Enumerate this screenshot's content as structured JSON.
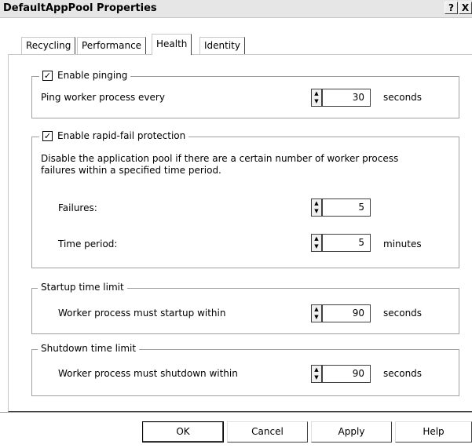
{
  "window": {
    "title": "DefaultAppPool Properties",
    "help_glyph": "?",
    "close_glyph": "X"
  },
  "tabs": [
    {
      "label": "Recycling",
      "active": false
    },
    {
      "label": "Performance",
      "active": false
    },
    {
      "label": "Health",
      "active": true
    },
    {
      "label": "Identity",
      "active": false
    }
  ],
  "pinging": {
    "checkbox_label": "Enable pinging",
    "checked": true,
    "row_label": "Ping worker process every",
    "value": "30",
    "unit": "seconds"
  },
  "rapid_fail": {
    "checkbox_label": "Enable rapid-fail protection",
    "checked": true,
    "description": "Disable the application pool if there are a certain number of worker process failures within a specified time period.",
    "failures_label": "Failures:",
    "failures_value": "5",
    "time_period_label": "Time period:",
    "time_period_value": "5",
    "time_period_unit": "minutes"
  },
  "startup": {
    "legend": "Startup time limit",
    "row_label": "Worker process must startup within",
    "value": "90",
    "unit": "seconds"
  },
  "shutdown": {
    "legend": "Shutdown time limit",
    "row_label": "Worker process must shutdown within",
    "value": "90",
    "unit": "seconds"
  },
  "buttons": {
    "ok": "OK",
    "cancel": "Cancel",
    "apply": "Apply",
    "help": "Help"
  },
  "glyphs": {
    "check": "✓",
    "spin_up": "▲",
    "spin_down": "▼"
  }
}
